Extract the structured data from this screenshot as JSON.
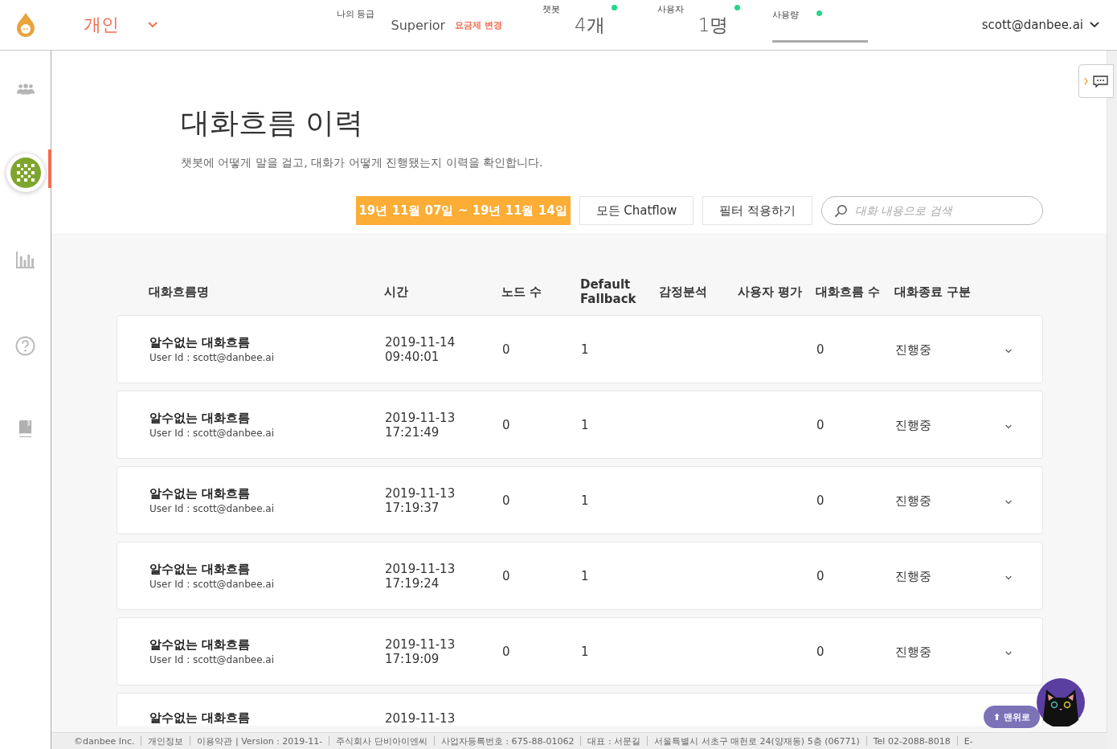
{
  "header": {
    "workspace": "개인",
    "plan": {
      "label": "나의 등급",
      "value": "Superior",
      "action": "요금제 변경"
    },
    "stats": [
      {
        "label": "챗봇",
        "value": "4개"
      },
      {
        "label": "사용자",
        "value": "1명"
      },
      {
        "label": "사용량"
      }
    ],
    "account": "scott@danbee.ai"
  },
  "sidebar": {
    "items": [
      {
        "kind": "people",
        "selected": false
      },
      {
        "kind": "avatar",
        "selected": true
      },
      {
        "kind": "chart",
        "selected": false
      },
      {
        "kind": "help",
        "selected": false
      },
      {
        "kind": "book",
        "selected": false
      }
    ]
  },
  "page": {
    "title": "대화흐름 이력",
    "subtitle": "챗봇에 어떻게 말을 걸고, 대화가 어떻게 진행됐는지 이력을 확인합니다.",
    "date_range": "19년 11월 07일 ~ 19년 11월 14일",
    "chatflow_filter": "모든 Chatflow",
    "apply_button": "필터 적용하기",
    "search": {
      "placeholder": "대화 내용으로 검색"
    }
  },
  "table": {
    "columns": [
      "대화흐름명",
      "시간",
      "노드 수",
      "Default Fallback",
      "감정분석",
      "사용자 평가",
      "대화흐름 수",
      "대화종료 구분"
    ],
    "rows": [
      {
        "name": "알수없는 대화흐름",
        "user": "User Id : scott@danbee.ai",
        "date": "2019-11-14",
        "time": "09:40:01",
        "nodes": "0",
        "fallback": "1",
        "count": "0",
        "end": "진행중"
      },
      {
        "name": "알수없는 대화흐름",
        "user": "User Id : scott@danbee.ai",
        "date": "2019-11-13",
        "time": "17:21:49",
        "nodes": "0",
        "fallback": "1",
        "count": "0",
        "end": "진행중"
      },
      {
        "name": "알수없는 대화흐름",
        "user": "User Id : scott@danbee.ai",
        "date": "2019-11-13",
        "time": "17:19:37",
        "nodes": "0",
        "fallback": "1",
        "count": "0",
        "end": "진행중"
      },
      {
        "name": "알수없는 대화흐름",
        "user": "User Id : scott@danbee.ai",
        "date": "2019-11-13",
        "time": "17:19:24",
        "nodes": "0",
        "fallback": "1",
        "count": "0",
        "end": "진행중"
      },
      {
        "name": "알수없는 대화흐름",
        "user": "User Id : scott@danbee.ai",
        "date": "2019-11-13",
        "time": "17:19:09",
        "nodes": "0",
        "fallback": "1",
        "count": "0",
        "end": "진행중"
      },
      {
        "name": "알수없는 대화흐름",
        "date": "2019-11-13"
      }
    ]
  },
  "scroll_top": "⬆ 맨위로",
  "footer": [
    "©danbee Inc.",
    "개인정보",
    "이용약관 | Version : 2019-11-",
    "주식회사 단비아이엔씨",
    "사업자등록번호 : 675-88-01062",
    "대표 : 서문길",
    "서울특별시 서초구 매헌로 24(양재동) 5층 (06771)",
    "Tel 02-2088-8018",
    "E-"
  ]
}
